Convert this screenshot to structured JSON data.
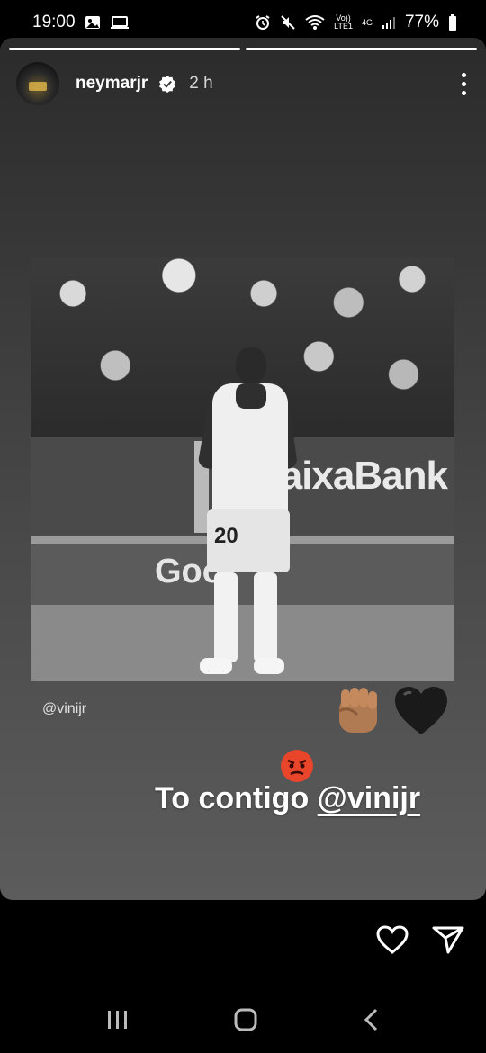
{
  "status_bar": {
    "time": "19:00",
    "volte": "Vo))\nLTE1",
    "network": "4G",
    "battery": "77%"
  },
  "story": {
    "progress_segments": 2,
    "username": "neymarjr",
    "verified": true,
    "time_ago": "2 h",
    "mention_small": "@vinijr",
    "photo": {
      "ad_text_1": "CaixaBank",
      "ad_text_2": "Goo",
      "jersey_number": "20"
    },
    "emojis": [
      "✊🏾",
      "🖤",
      "😡"
    ],
    "caption_text": "To contigo",
    "caption_tag": "@vinijr"
  },
  "actions": {
    "like_icon": "heart-icon",
    "share_icon": "send-icon"
  },
  "nav": {
    "recents_icon": "recents-icon",
    "home_icon": "home-icon",
    "back_icon": "back-icon"
  }
}
